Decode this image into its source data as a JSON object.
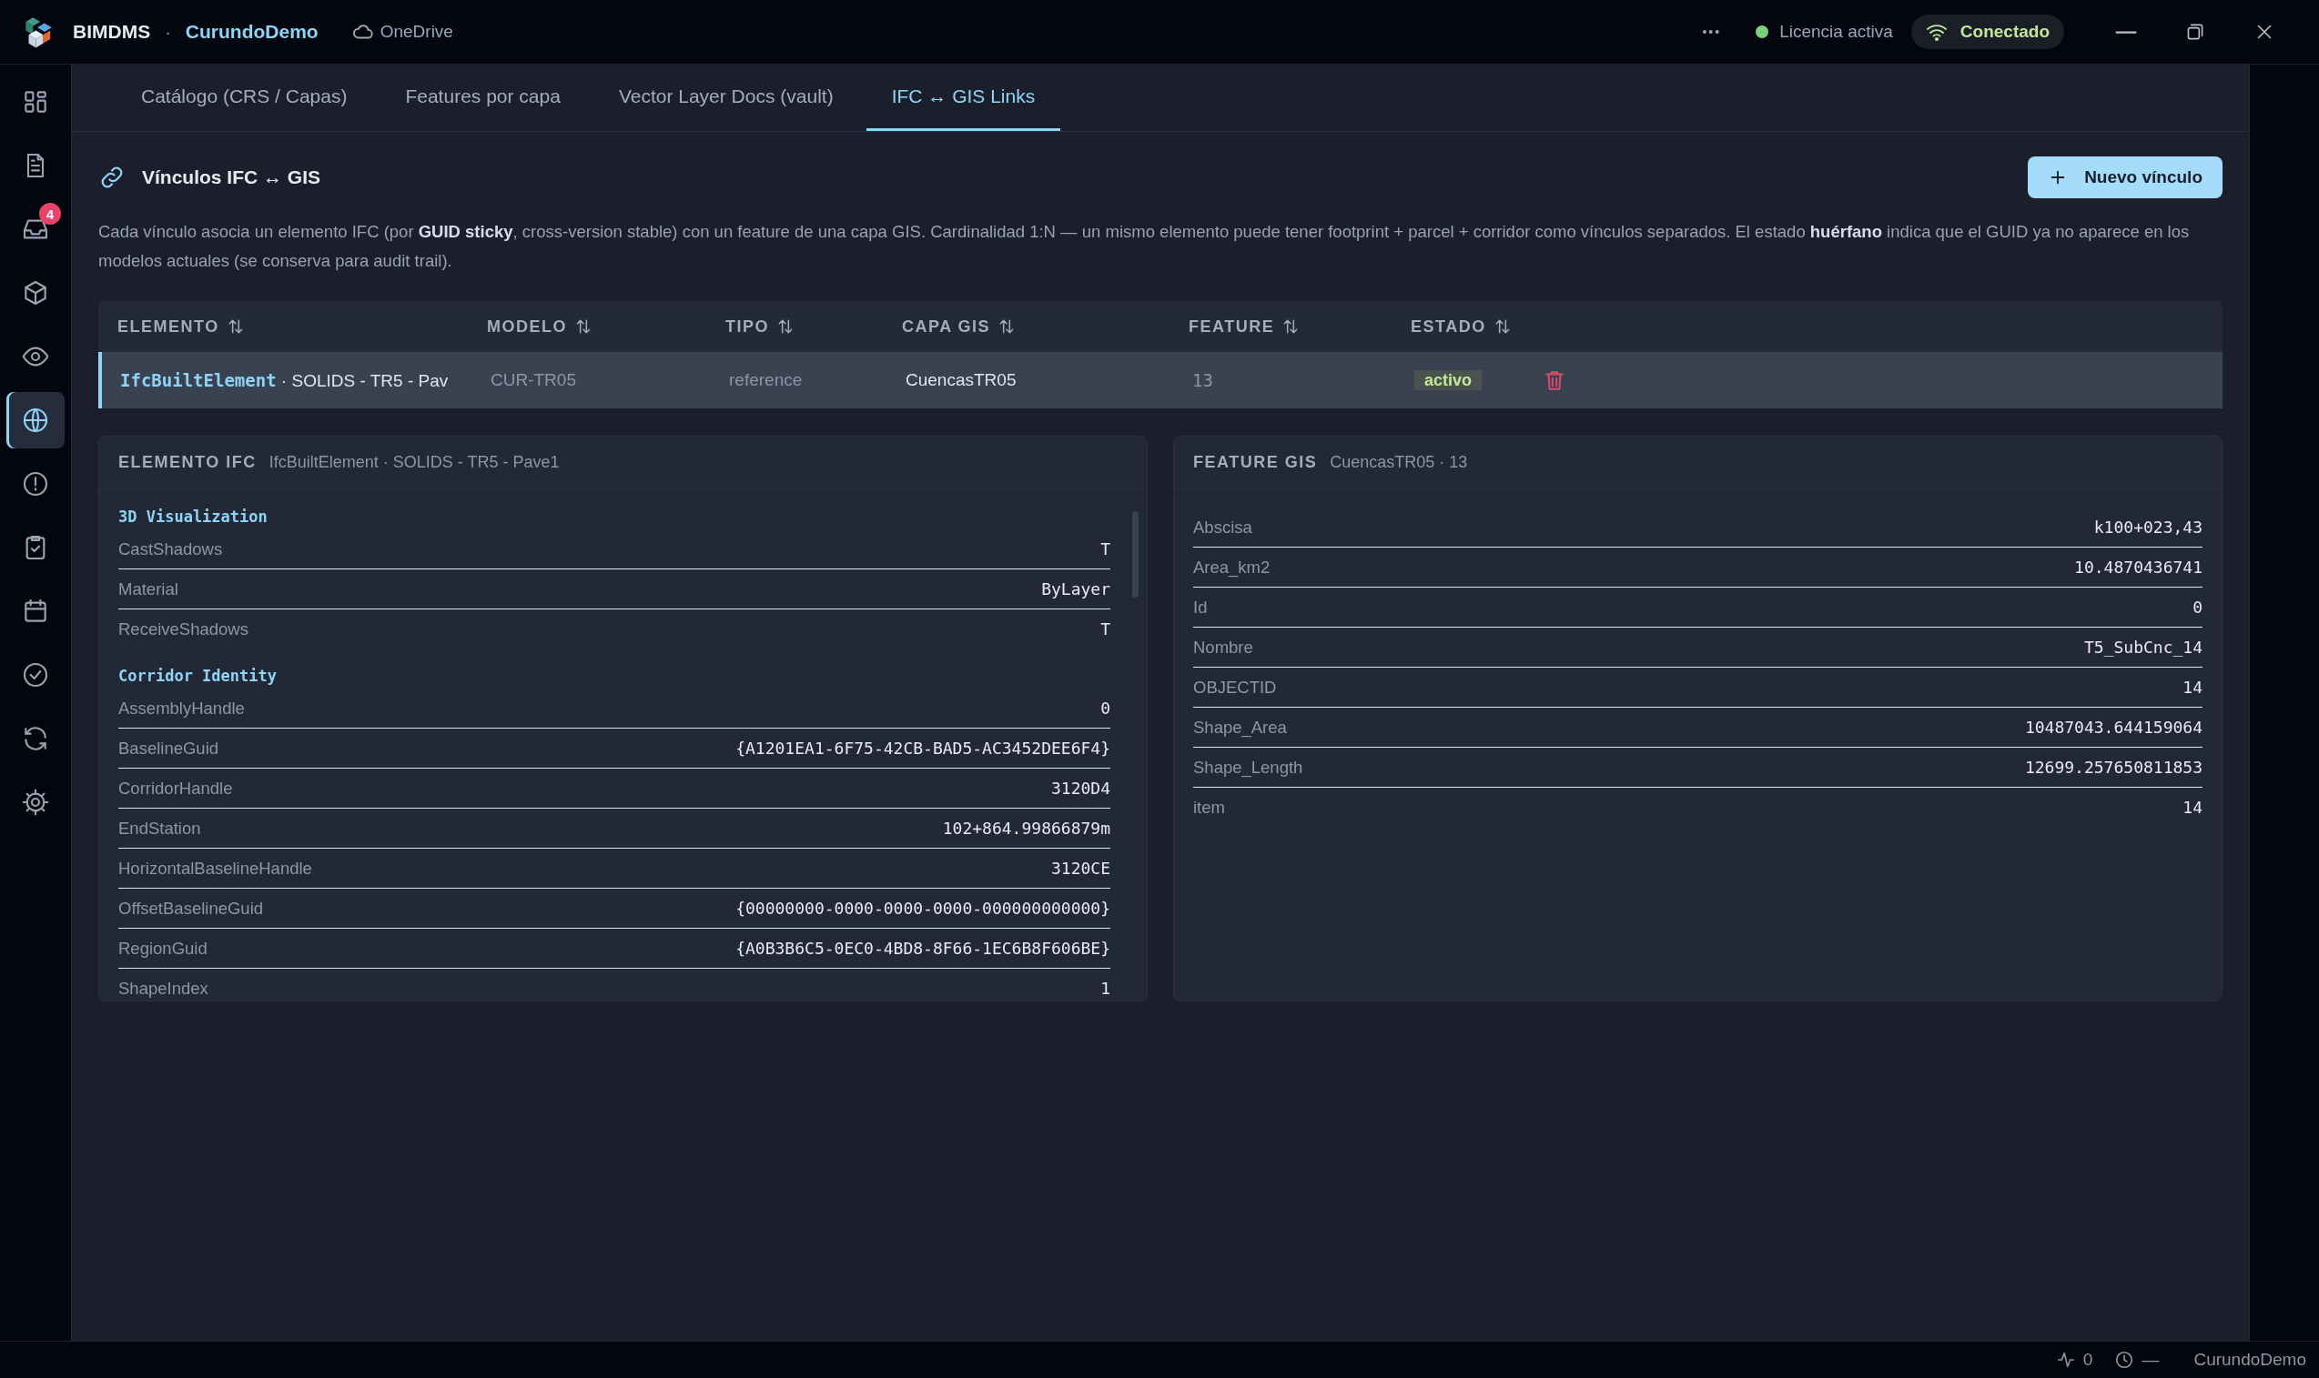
{
  "titlebar": {
    "app_name": "BIMDMS",
    "separator": "·",
    "workspace": "CurundoDemo",
    "storage": "OneDrive",
    "more": "•••",
    "license": "Licencia activa",
    "connection": "Conectado"
  },
  "sidebar": {
    "items": [
      {
        "selected": false
      },
      {
        "selected": false
      },
      {
        "selected": false,
        "badge": "4"
      },
      {
        "selected": false
      },
      {
        "selected": false
      },
      {
        "selected": true
      },
      {
        "selected": false
      },
      {
        "selected": false
      },
      {
        "selected": false
      },
      {
        "selected": false
      },
      {
        "selected": false
      },
      {
        "selected": false
      }
    ]
  },
  "tabs": [
    {
      "label": "Catálogo (CRS / Capas)",
      "selected": false
    },
    {
      "label": "Features por capa",
      "selected": false
    },
    {
      "label": "Vector Layer Docs (vault)",
      "selected": false
    },
    {
      "label": "IFC ↔ GIS Links",
      "selected": true
    }
  ],
  "section": {
    "title": "Vínculos IFC ↔ GIS",
    "new_button": "Nuevo vínculo",
    "description": "Cada vínculo asocia un elemento IFC (por **GUID sticky**, cross-version stable) con un feature de una capa GIS. Cardinalidad 1:N — un mismo elemento puede tener footprint + parcel + corridor como vínculos separados. El estado **huérfano** indica que el GUID ya no aparece en los modelos actuales (se conserva para audit trail)."
  },
  "table": {
    "columns": [
      "ELEMENTO",
      "MODELO",
      "TIPO",
      "CAPA GIS",
      "FEATURE",
      "ESTADO"
    ],
    "rows": [
      {
        "selected": true,
        "element_class": "IfcBuiltElement",
        "element_name": "· SOLIDS - TR5 - Pav",
        "model": "CUR-TR05",
        "type": "reference",
        "layer": "CuencasTR05",
        "feature": "13",
        "status": "activo"
      }
    ]
  },
  "ifc_panel": {
    "title": "ELEMENTO IFC",
    "subtitle": "IfcBuiltElement · SOLIDS - TR5 - Pave1",
    "groups": [
      {
        "name": "3D Visualization",
        "properties": [
          {
            "key": "CastShadows",
            "value": "T"
          },
          {
            "key": "Material",
            "value": "ByLayer"
          },
          {
            "key": "ReceiveShadows",
            "value": "T"
          }
        ]
      },
      {
        "name": "Corridor Identity",
        "properties": [
          {
            "key": "AssemblyHandle",
            "value": "0"
          },
          {
            "key": "BaselineGuid",
            "value": "{A1201EA1-6F75-42CB-BAD5-AC3452DEE6F4}"
          },
          {
            "key": "CorridorHandle",
            "value": "3120D4"
          },
          {
            "key": "EndStation",
            "value": "102+864.99866879m"
          },
          {
            "key": "HorizontalBaselineHandle",
            "value": "3120CE"
          },
          {
            "key": "OffsetBaselineGuid",
            "value": "{00000000-0000-0000-0000-000000000000}"
          },
          {
            "key": "RegionGuid",
            "value": "{A0B3B6C5-0EC0-4BD8-8F66-1EC6B8F606BE}"
          },
          {
            "key": "ShapeIndex",
            "value": "1"
          }
        ]
      }
    ]
  },
  "gis_panel": {
    "title": "FEATURE GIS",
    "subtitle": "CuencasTR05 · 13",
    "properties": [
      {
        "key": "Abscisa",
        "value": "k100+023,43"
      },
      {
        "key": "Area_km2",
        "value": "10.4870436741"
      },
      {
        "key": "Id",
        "value": "0"
      },
      {
        "key": "Nombre",
        "value": "T5_SubCnc_14"
      },
      {
        "key": "OBJECTID",
        "value": "14"
      },
      {
        "key": "Shape_Area",
        "value": "10487043.644159064"
      },
      {
        "key": "Shape_Length",
        "value": "12699.257650811853"
      },
      {
        "key": "item",
        "value": "14"
      }
    ]
  },
  "status_bar": {
    "activity": "0",
    "last_sync": "—",
    "workspace": "CurundoDemo"
  }
}
